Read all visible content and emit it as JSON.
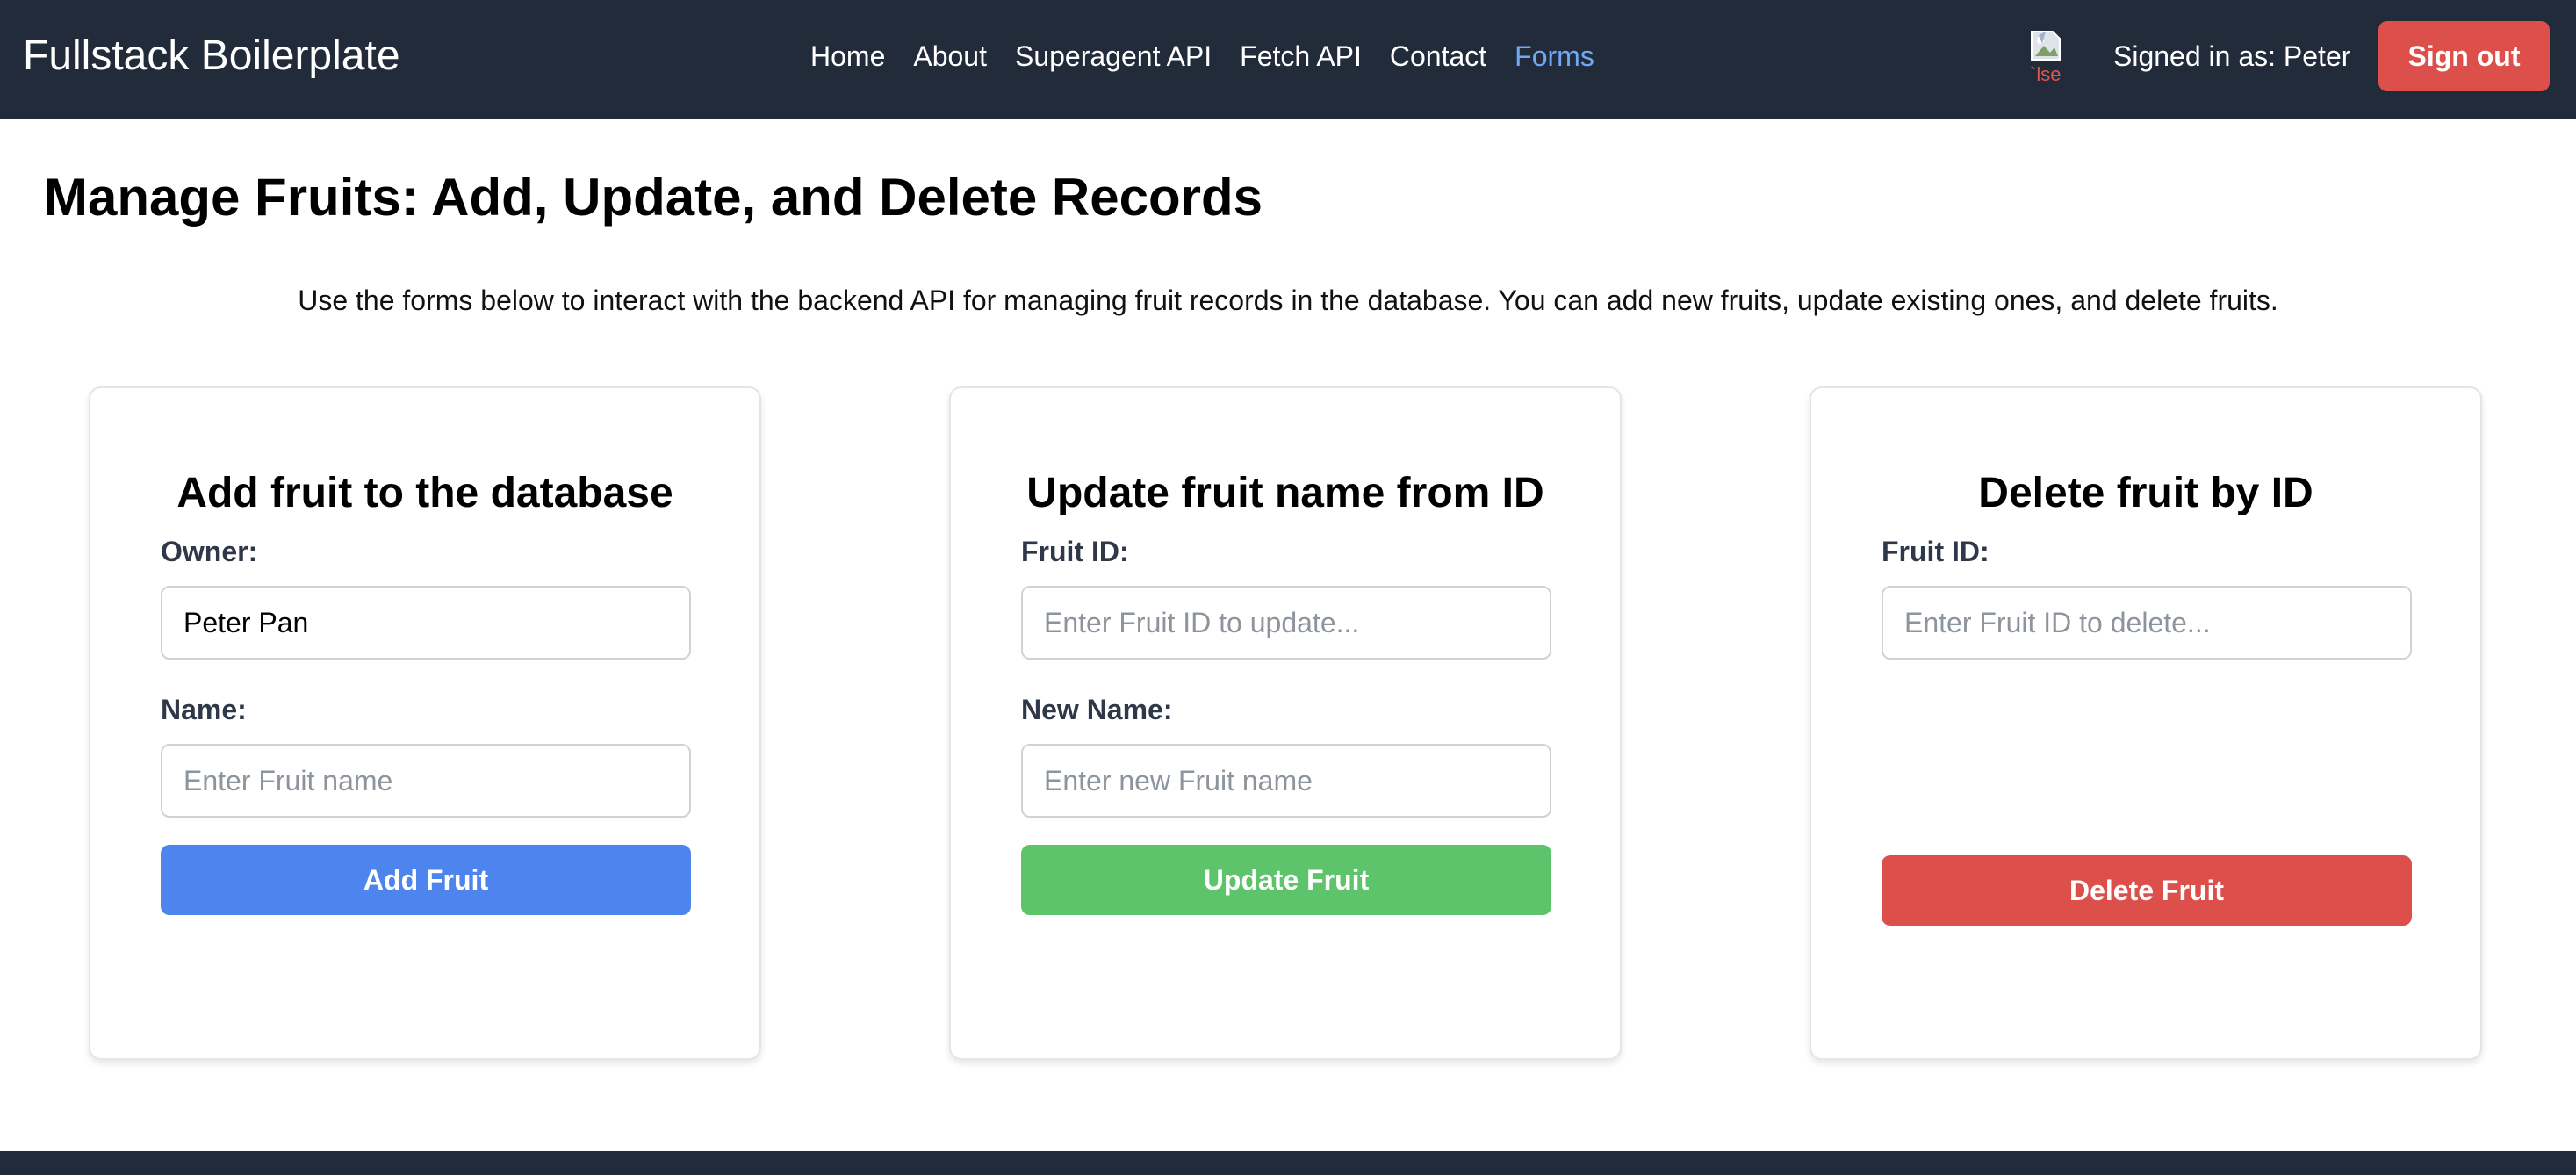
{
  "navbar": {
    "brand": "Fullstack Boilerplate",
    "links": [
      {
        "label": "Home",
        "active": false
      },
      {
        "label": "About",
        "active": false
      },
      {
        "label": "Superagent API",
        "active": false
      },
      {
        "label": "Fetch API",
        "active": false
      },
      {
        "label": "Contact",
        "active": false
      },
      {
        "label": "Forms",
        "active": true
      }
    ],
    "avatar_alt_fragment": "`lse",
    "signed_in_text": "Signed in as: Peter",
    "sign_out_label": "Sign out"
  },
  "page": {
    "title": "Manage Fruits: Add, Update, and Delete Records",
    "description": "Use the forms below to interact with the backend API for managing fruit records in the database. You can add new fruits, update existing ones, and delete fruits."
  },
  "forms": {
    "add": {
      "title": "Add fruit to the database",
      "owner_label": "Owner:",
      "owner_value": "Peter Pan",
      "name_label": "Name:",
      "name_placeholder": "Enter Fruit name",
      "button_label": "Add Fruit"
    },
    "update": {
      "title": "Update fruit name from ID",
      "id_label": "Fruit ID:",
      "id_placeholder": "Enter Fruit ID to update...",
      "name_label": "New Name:",
      "name_placeholder": "Enter new Fruit name",
      "button_label": "Update Fruit"
    },
    "delete": {
      "title": "Delete fruit by ID",
      "id_label": "Fruit ID:",
      "id_placeholder": "Enter Fruit ID to delete...",
      "button_label": "Delete Fruit"
    }
  },
  "colors": {
    "navbar_bg": "#222b3a",
    "active_link": "#6fa8f5",
    "add_button": "#4e84ee",
    "update_button": "#5dc46b",
    "delete_button": "#dd4f4a",
    "sign_out_button": "#dd4f4a"
  },
  "icons": {
    "avatar": "broken-image-icon"
  }
}
